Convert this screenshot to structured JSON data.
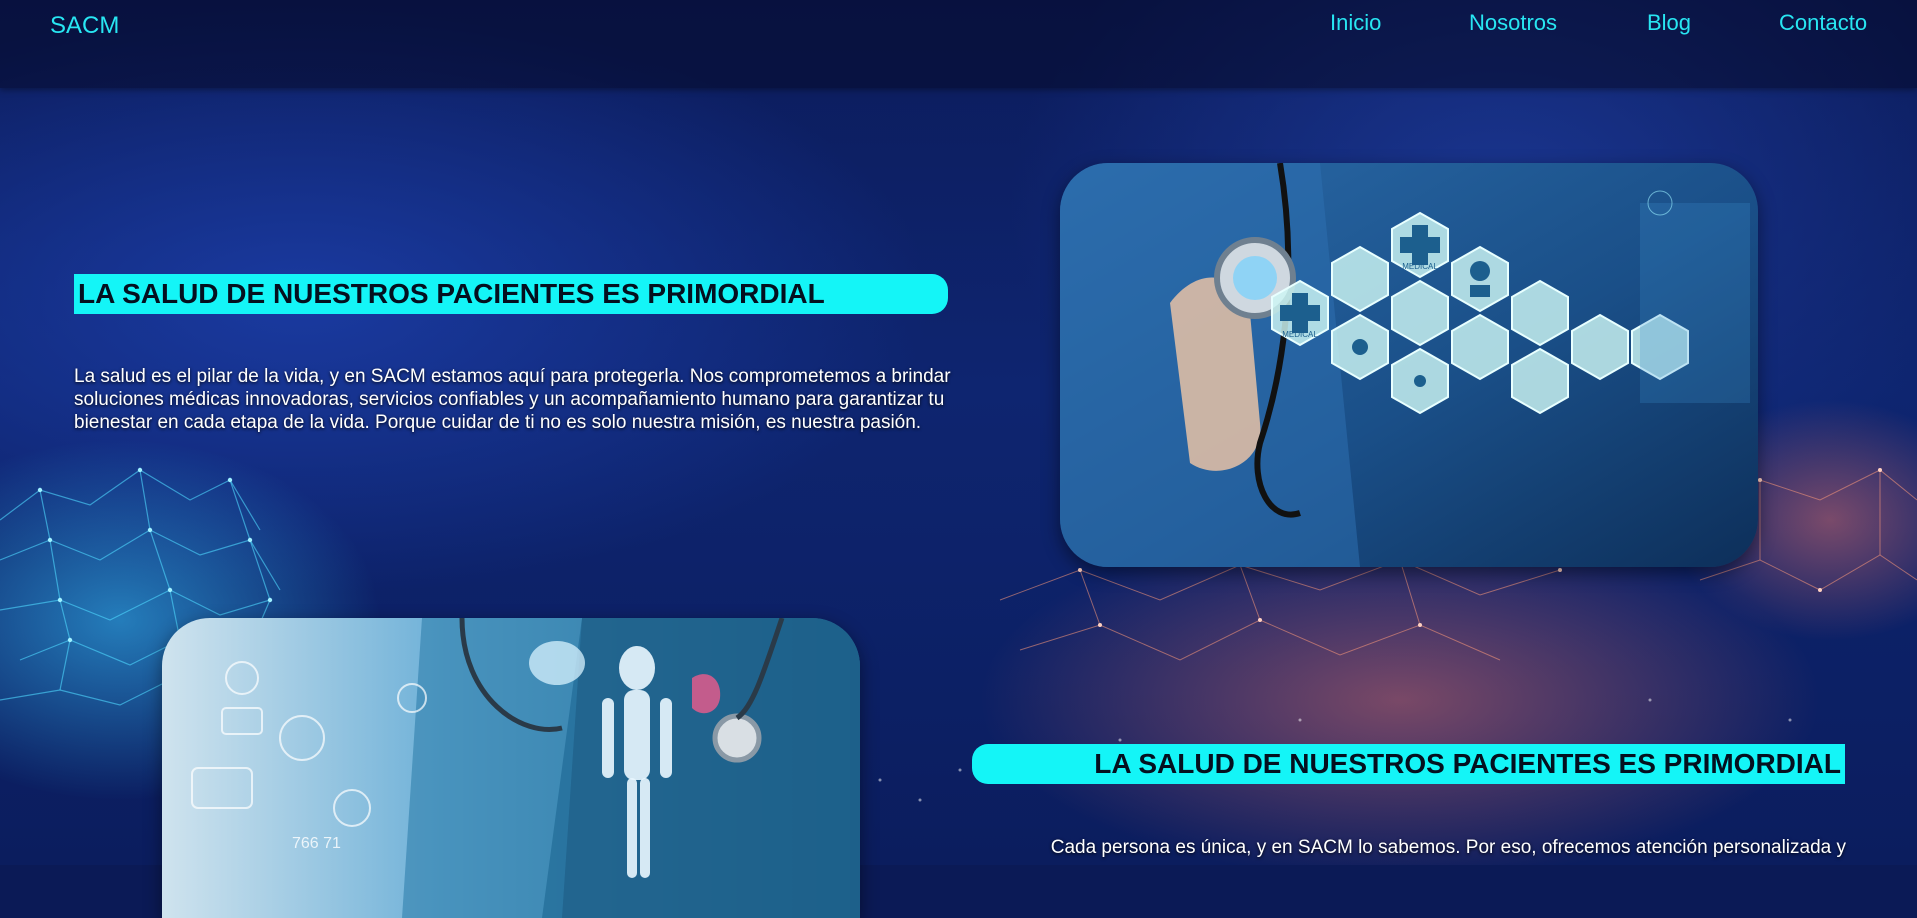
{
  "brand": "SACM",
  "nav": {
    "items": [
      {
        "label": "Inicio"
      },
      {
        "label": "Nosotros"
      },
      {
        "label": "Blog"
      },
      {
        "label": "Contacto"
      }
    ]
  },
  "hero": {
    "heading": "LA SALUD DE NUESTROS PACIENTES ES PRIMORDIAL",
    "text": "La salud es el pilar de la vida, y en SACM estamos aquí para protegerla. Nos comprometemos a brindar soluciones médicas innovadoras, servicios confiables y un acompañamiento humano para garantizar tu bienestar en cada etapa de la vida. Porque cuidar de ti no es solo nuestra misión, es nuestra pasión.",
    "image_labels": [
      "MEDICAL",
      "MEDICAL"
    ]
  },
  "section2": {
    "heading": "LA SALUD DE NUESTROS PACIENTES ES PRIMORDIAL",
    "text": "Cada persona es única, y en SACM lo sabemos. Por eso, ofrecemos atención personalizada y",
    "image_label": "766 71"
  },
  "colors": {
    "accent": "#14f5f7",
    "nav_text": "#28e6f2",
    "background": "#0b1a56"
  }
}
